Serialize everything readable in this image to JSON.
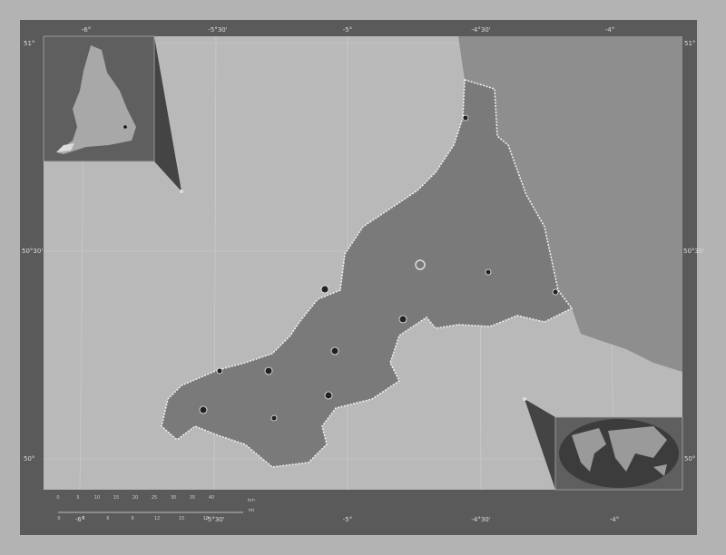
{
  "map": {
    "top_lon_labels": [
      "-6°",
      "-5°30'",
      "-5°",
      "-4°30'",
      "-4°"
    ],
    "bottom_lon_labels": [
      "-6°",
      "-5°30'",
      "-5°",
      "-4°30'",
      "-4°"
    ],
    "left_lat_labels": [
      "51°",
      "50°30'",
      "50°"
    ],
    "right_lat_labels": [
      "51°",
      "50°30'",
      "50°"
    ],
    "scale_km": [
      "0",
      "5",
      "10",
      "15",
      "20",
      "25",
      "30",
      "35",
      "40"
    ],
    "scale_km_unit": "km",
    "scale_mi": [
      "0",
      "3",
      "6",
      "9",
      "12",
      "15",
      "18"
    ],
    "scale_mi_unit": "mi",
    "colors": {
      "sea": "#b9b9b9",
      "land_region": "#7c7c7c",
      "land_other": "#8e8e8e",
      "frame": "#5a5a5a"
    }
  }
}
